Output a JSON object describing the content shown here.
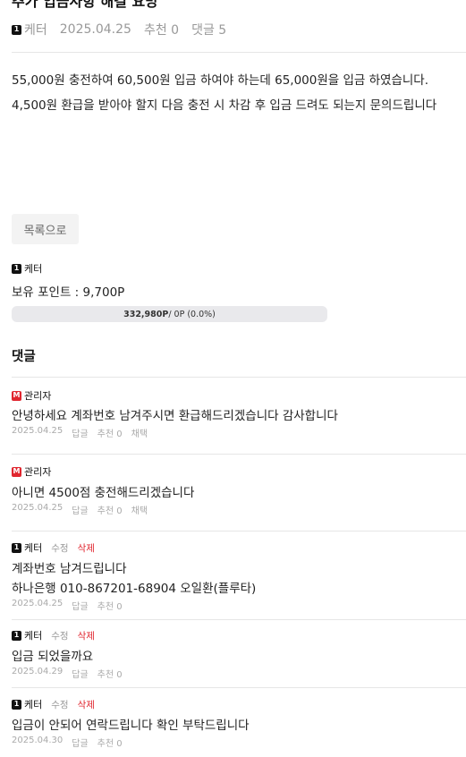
{
  "post": {
    "title": "추가 입금사항 해결 요망",
    "author_badge": "1",
    "author": "케터",
    "date": "2025.04.25",
    "recommend": "추천 0",
    "comments_count": "댓글 5",
    "body_lines": [
      "55,000원 충전하여 60,500원 입금 하여야 하는데 65,000원을 입금 하였습니다.",
      "4,500원 환급을 받아야 할지 다음 충전 시 차감 후 입금 드려도 되는지 문의드립니다"
    ],
    "list_button": "목록으로"
  },
  "profile": {
    "badge": "1",
    "name": "케터",
    "points_text": "보유 포인트 : 9,700P",
    "progress": {
      "value_strong": "332,980P",
      "value_rest": " / 0P (0.0%)",
      "percent": 0
    }
  },
  "comments_section": {
    "heading": "댓글"
  },
  "comments": [
    {
      "badge": "M",
      "badge_color": "#e0262f",
      "author": "관리자",
      "lines": [
        "안녕하세요 계좌번호 남겨주시면 환급해드리겠습니다 감사합니다"
      ],
      "date": "2025.04.25",
      "reply": "답글",
      "recommend": "추천 0",
      "extra": "채택"
    },
    {
      "badge": "M",
      "badge_color": "#e0262f",
      "author": "관리자",
      "lines": [
        "아니면 4500점 충전해드리겠습니다"
      ],
      "date": "2025.04.25",
      "reply": "답글",
      "recommend": "추천 0",
      "extra": "채택"
    },
    {
      "badge": "1",
      "badge_color": "#111111",
      "author": "케터",
      "edit": "수정",
      "delete": "삭제",
      "lines": [
        "계좌번호 남겨드립니다",
        "하나은행 010-867201-68904 오일환(플루타)"
      ],
      "date": "2025.04.25",
      "reply": "답글",
      "recommend": "추천 0"
    },
    {
      "badge": "1",
      "badge_color": "#111111",
      "author": "케터",
      "edit": "수정",
      "delete": "삭제",
      "lines": [
        "입금 되었을까요"
      ],
      "date": "2025.04.29",
      "reply": "답글",
      "recommend": "추천 0"
    },
    {
      "badge": "1",
      "badge_color": "#111111",
      "author": "케터",
      "edit": "수정",
      "delete": "삭제",
      "lines": [
        "입금이 안되어 연락드립니다 확인 부탁드립니다"
      ],
      "date": "2025.04.30",
      "reply": "답글",
      "recommend": "추천 0"
    }
  ]
}
